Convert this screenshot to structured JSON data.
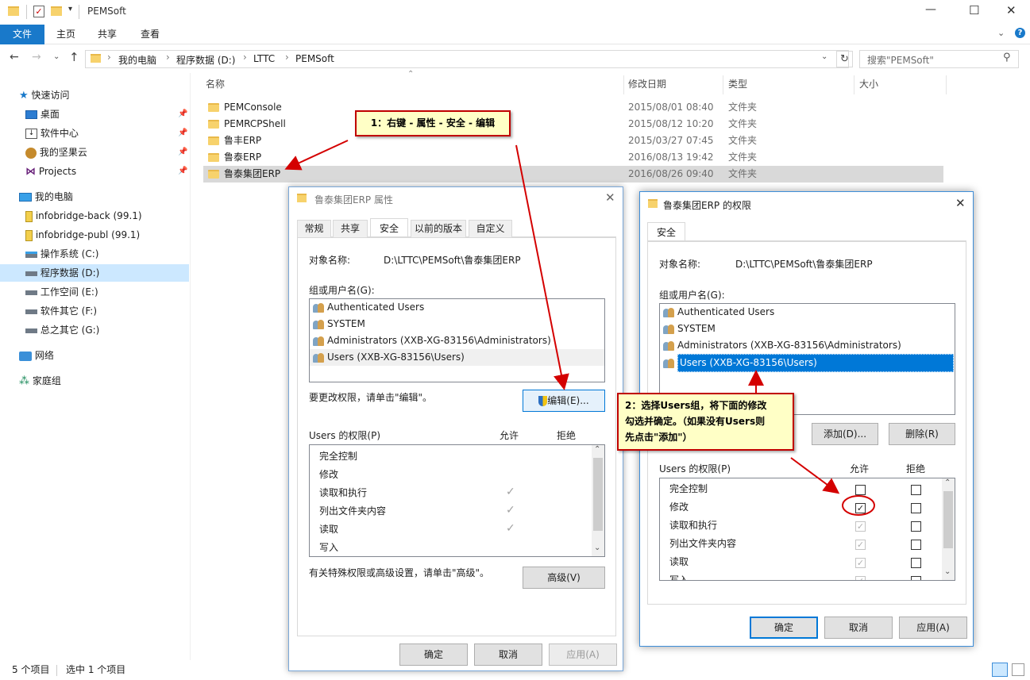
{
  "window": {
    "title": "PEMSoft",
    "controls": [
      "—",
      "☐",
      "✕"
    ]
  },
  "ribbon": {
    "tabs": [
      {
        "label": "文件",
        "active": true
      },
      {
        "label": "主页"
      },
      {
        "label": "共享"
      },
      {
        "label": "查看"
      }
    ]
  },
  "address": {
    "crumbs": [
      "我的电脑",
      "程序数据 (D:)",
      "LTTC",
      "PEMSoft"
    ],
    "search_placeholder": "搜索\"PEMSoft\""
  },
  "sidebar": {
    "quick_access": "快速访问",
    "quick_items": [
      "桌面",
      "软件中心",
      "我的坚果云",
      "Projects"
    ],
    "this_pc": "我的电脑",
    "drives": [
      "infobridge-back (99.1)",
      "infobridge-publ (99.1)",
      "操作系统 (C:)",
      "程序数据 (D:)",
      "工作空间 (E:)",
      "软件其它 (F:)",
      "总之其它 (G:)"
    ],
    "network": "网络",
    "homegroup": "家庭组"
  },
  "filelist": {
    "headers": {
      "name": "名称",
      "modified": "修改日期",
      "type": "类型",
      "size": "大小"
    },
    "rows": [
      {
        "name": "PEMConsole",
        "date": "2015/08/01 08:40",
        "type": "文件夹"
      },
      {
        "name": "PEMRCPShell",
        "date": "2015/08/12 10:20",
        "type": "文件夹"
      },
      {
        "name": "鲁丰ERP",
        "date": "2015/03/27 07:45",
        "type": "文件夹"
      },
      {
        "name": "鲁泰ERP",
        "date": "2016/08/13 19:42",
        "type": "文件夹"
      },
      {
        "name": "鲁泰集团ERP",
        "date": "2016/08/26 09:40",
        "type": "文件夹",
        "selected": true
      }
    ]
  },
  "status": {
    "count": "5 个项目",
    "selected": "选中 1 个项目"
  },
  "props_dialog": {
    "title": "鲁泰集团ERP 属性",
    "tabs": [
      "常规",
      "共享",
      "安全",
      "以前的版本",
      "自定义"
    ],
    "active_tab": "安全",
    "object_label": "对象名称:",
    "object_value": "D:\\LTTC\\PEMSoft\\鲁泰集团ERP",
    "group_label": "组或用户名(G):",
    "users": [
      "Authenticated Users",
      "SYSTEM",
      "Administrators (XXB-XG-83156\\Administrators)",
      "Users (XXB-XG-83156\\Users)"
    ],
    "change_hint": "要更改权限，请单击\"编辑\"。",
    "edit_button": "编辑(E)...",
    "perm_title": "Users 的权限(P)",
    "allow": "允许",
    "deny": "拒绝",
    "perms": [
      {
        "name": "完全控制",
        "allow": false
      },
      {
        "name": "修改",
        "allow": false
      },
      {
        "name": "读取和执行",
        "allow": true
      },
      {
        "name": "列出文件夹内容",
        "allow": true
      },
      {
        "name": "读取",
        "allow": true
      },
      {
        "name": "写入",
        "allow": false
      }
    ],
    "advanced_hint": "有关特殊权限或高级设置，请单击\"高级\"。",
    "advanced_button": "高级(V)",
    "ok": "确定",
    "cancel": "取消",
    "apply": "应用(A)"
  },
  "perm_dialog": {
    "title": "鲁泰集团ERP 的权限",
    "tab": "安全",
    "object_label": "对象名称:",
    "object_value": "D:\\LTTC\\PEMSoft\\鲁泰集团ERP",
    "group_label": "组或用户名(G):",
    "users": [
      "Authenticated Users",
      "SYSTEM",
      "Administrators (XXB-XG-83156\\Administrators)",
      "Users (XXB-XG-83156\\Users)"
    ],
    "selected_user_index": 3,
    "add_button": "添加(D)...",
    "remove_button": "删除(R)",
    "perm_title": "Users 的权限(P)",
    "allow": "允许",
    "deny": "拒绝",
    "perms": [
      {
        "name": "完全控制",
        "allow": "empty"
      },
      {
        "name": "修改",
        "allow": "checked"
      },
      {
        "name": "读取和执行",
        "allow": "gray"
      },
      {
        "name": "列出文件夹内容",
        "allow": "gray"
      },
      {
        "name": "读取",
        "allow": "gray"
      },
      {
        "name": "写入",
        "allow": "gray"
      }
    ],
    "ok": "确定",
    "cancel": "取消",
    "apply": "应用(A)"
  },
  "annotations": {
    "callout1": "1：右键 - 属性 - 安全 - 编辑",
    "callout2_line1": "2：选择Users组，将下面的修改",
    "callout2_line2": "勾选并确定。（如果没有Users则",
    "callout2_line3": "先点击\"添加\"）",
    "arrow_color": "#d40000"
  }
}
